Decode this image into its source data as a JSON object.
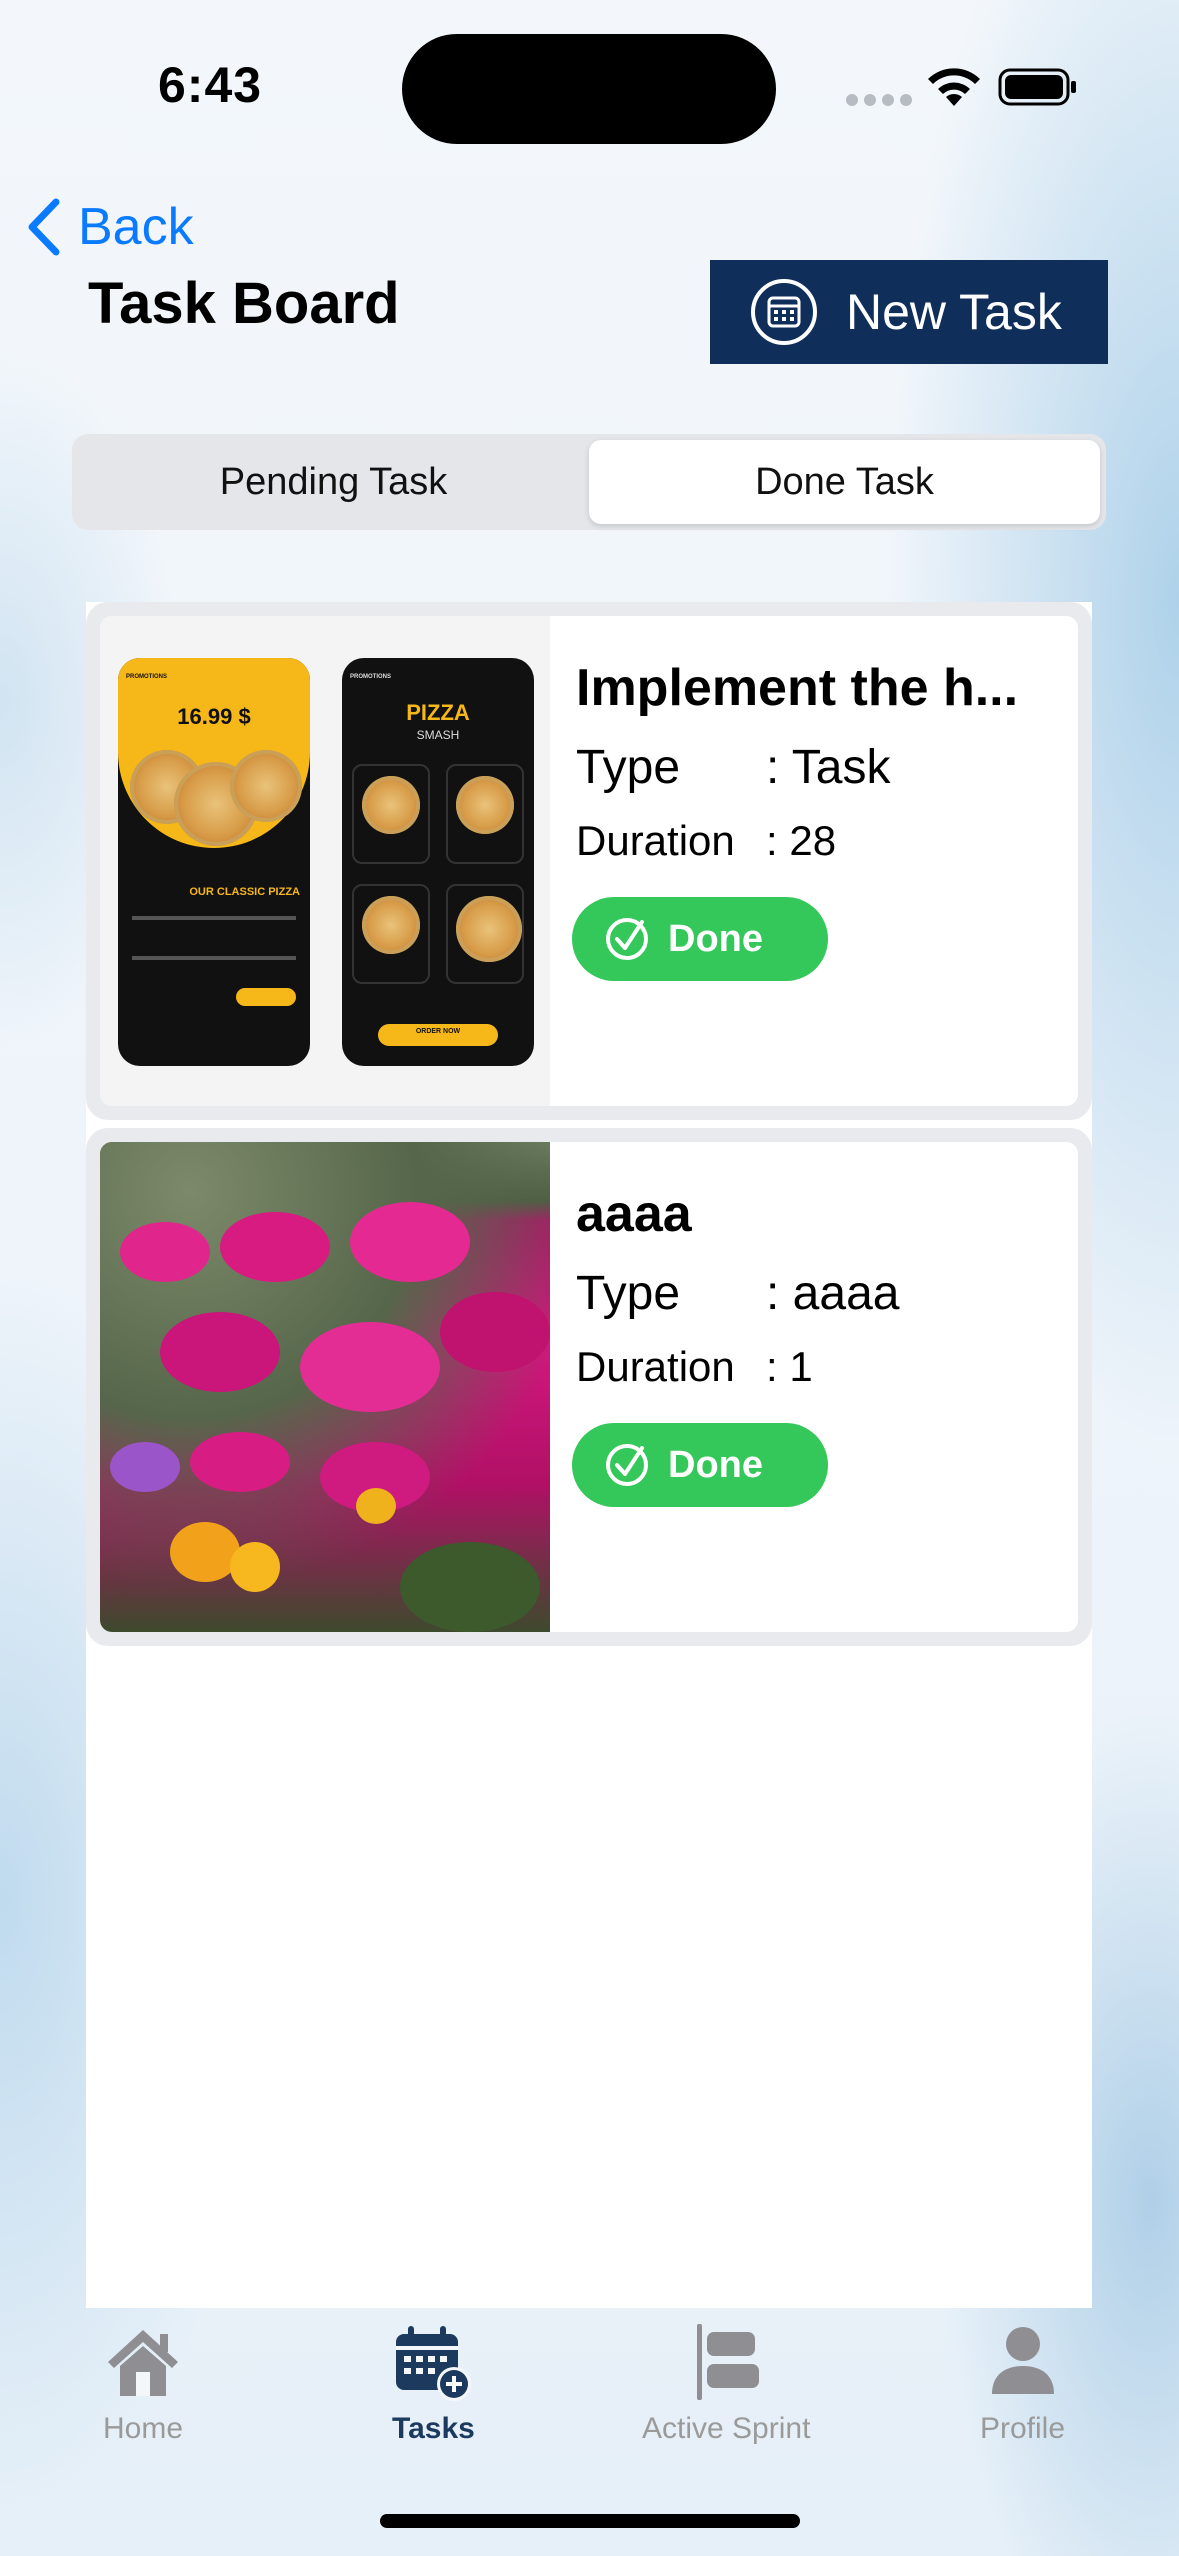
{
  "status_bar": {
    "time": "6:43"
  },
  "nav": {
    "back_label": "Back",
    "title": "Task Board",
    "new_task_label": "New Task"
  },
  "segment": {
    "options": [
      "Pending Task",
      "Done Task"
    ],
    "selected": "Done Task"
  },
  "tasks": [
    {
      "title": "Implement the h...",
      "type_label": "Type",
      "type_value": ": Task",
      "duration_label": "Duration",
      "duration_value": ": 28",
      "status_label": "Done",
      "thumb_text": {
        "promo": "PROMOTIONS",
        "price": "16.99 $",
        "classic": "OUR CLASSIC PIZZA",
        "pizza": "PIZZA",
        "smash": "SMASH",
        "order": "ORDER NOW"
      }
    },
    {
      "title": "aaaa",
      "type_label": "Type",
      "type_value": ": aaaa",
      "duration_label": "Duration",
      "duration_value": ": 1",
      "status_label": "Done"
    }
  ],
  "tabbar": {
    "items": [
      {
        "label": "Home",
        "icon": "house-icon"
      },
      {
        "label": "Tasks",
        "icon": "calendar-plus-icon"
      },
      {
        "label": "Active Sprint",
        "icon": "bars-left-icon"
      },
      {
        "label": "Profile",
        "icon": "person-icon"
      }
    ],
    "active": "Tasks"
  },
  "colors": {
    "accent": "#0f2e5a",
    "done": "#34c759",
    "link": "#0a7aff"
  }
}
